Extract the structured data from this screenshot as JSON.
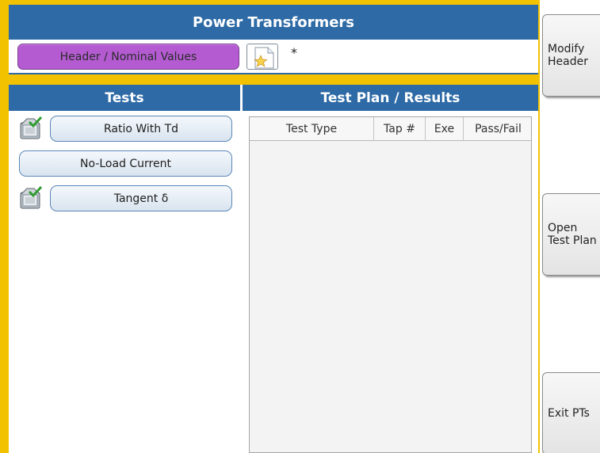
{
  "title": "Power Transformers",
  "header": {
    "button_label": "Header / Nominal Values",
    "field_value": "*"
  },
  "tests_panel": {
    "title": "Tests",
    "items": [
      {
        "label": "Ratio With Td",
        "completed": true
      },
      {
        "label": "No-Load Current",
        "completed": false
      },
      {
        "label": "Tangent δ",
        "completed": true
      }
    ]
  },
  "plan_panel": {
    "title": "Test Plan / Results",
    "columns": [
      "Test Type",
      "Tap #",
      "Exe",
      "Pass/Fail"
    ],
    "rows": []
  },
  "side_buttons": {
    "modify_header": "Modify\nHeader",
    "open_test_plan": "Open\nTest Plan",
    "exit": "Exit PTs"
  },
  "colors": {
    "accent_blue": "#2e6aa5",
    "frame_yellow": "#f2c200",
    "header_button_purple": "#b45bd1"
  }
}
